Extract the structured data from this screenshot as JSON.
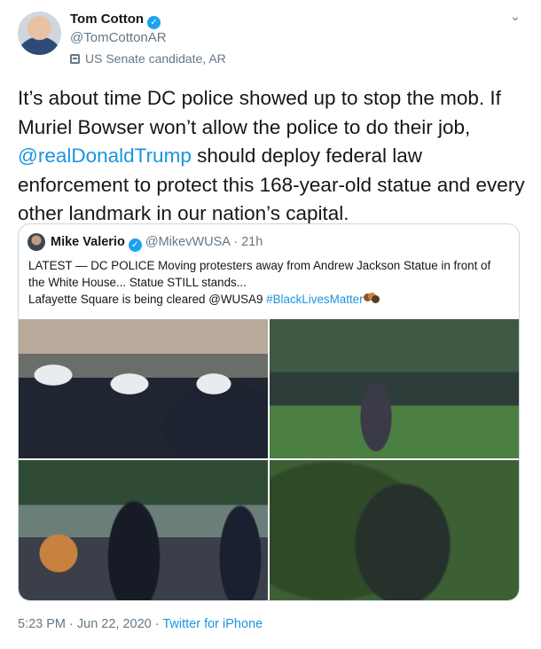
{
  "author": {
    "name": "Tom Cotton",
    "handle": "@TomCottonAR",
    "label": "US Senate candidate, AR"
  },
  "tweet": {
    "text_before": "It’s about time DC police showed up to stop the mob. If Muriel Bowser won’t allow the police to do their job, ",
    "mention": "@realDonaldTrump",
    "text_after": " should deploy federal law enforcement to protect this 168-year-old statue and every other landmark in our nation’s capital."
  },
  "quoted": {
    "name": "Mike Valerio",
    "handle": "@MikevWUSA",
    "separator": "·",
    "time": "21h",
    "line1": "LATEST — DC POLICE Moving protesters away from Andrew Jackson Statue in front of the White House... Statue STILL stands...",
    "line2": "Lafayette Square is being cleared @WUSA9 ",
    "hashtag": "#BlackLivesMatter"
  },
  "footer": {
    "time": "5:23 PM · Jun 22, 2020 · ",
    "source": "Twitter for iPhone"
  },
  "colors": {
    "accent": "#1b95e0",
    "verified": "#1da1f2",
    "muted": "#657786"
  },
  "icons": [
    "verified-badge-icon",
    "ballot-box-icon",
    "chevron-down-icon",
    "raised-fist-emoji-icon"
  ]
}
